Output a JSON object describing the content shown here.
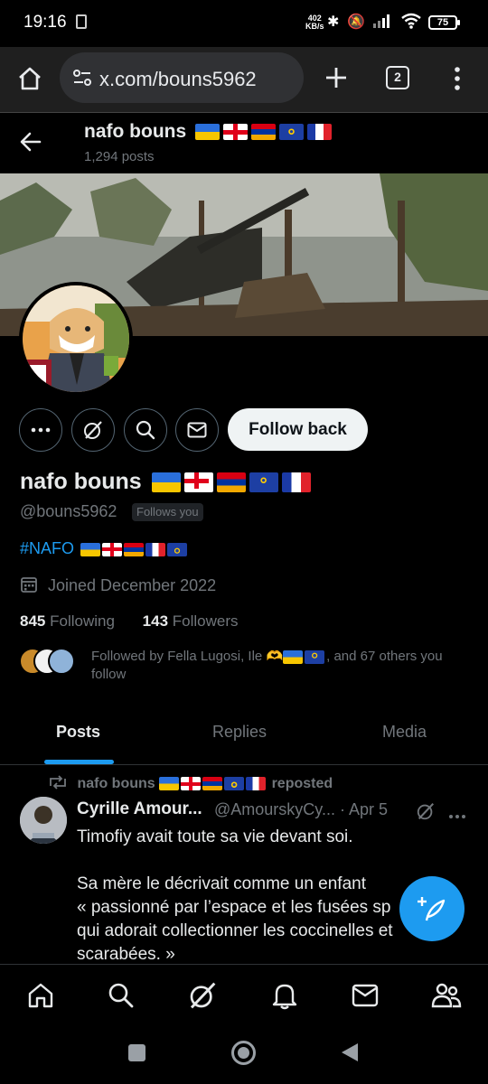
{
  "status_bar": {
    "time": "19:16",
    "net_speed": "402",
    "net_unit": "KB/s",
    "battery": "75"
  },
  "browser": {
    "url": "x.com/bouns5962",
    "tab_count": "2"
  },
  "header": {
    "name": "nafo bouns",
    "posts": "1,294 posts"
  },
  "profile": {
    "name": "nafo bouns",
    "handle": "@bouns5962",
    "follows_you": "Follows you",
    "bio": "#NAFO",
    "joined": "Joined December 2022",
    "following_count": "845",
    "following_label": "Following",
    "followers_count": "143",
    "followers_label": "Followers",
    "followed_by_prefix": "Followed by Fella Lugosi, Ile",
    "followed_by_suffix": ", and 67 others you follow",
    "flags": [
      "ukraine",
      "georgia",
      "armenia",
      "eu",
      "france"
    ]
  },
  "actions": {
    "follow_back": "Follow back"
  },
  "tabs": [
    {
      "label": "Posts",
      "active": true
    },
    {
      "label": "Replies",
      "active": false
    },
    {
      "label": "Media",
      "active": false
    }
  ],
  "post": {
    "repost_by": "nafo bouns",
    "repost_label": "reposted",
    "author": "Cyrille Amour...",
    "handle": "@AmourskyCy...",
    "date": "· Apr 5",
    "text": "Timofiy avait toute sa vie devant soi.\n\nSa mère le décrivait comme un enfant\n« passionné par l’espace et les fusées sp\nqui adorait collectionner les coccinelles et\nscarabées. »"
  },
  "colors": {
    "accent": "#1d9bf0",
    "background": "#000000",
    "text": "#e7e9ea",
    "muted": "#71767b"
  }
}
